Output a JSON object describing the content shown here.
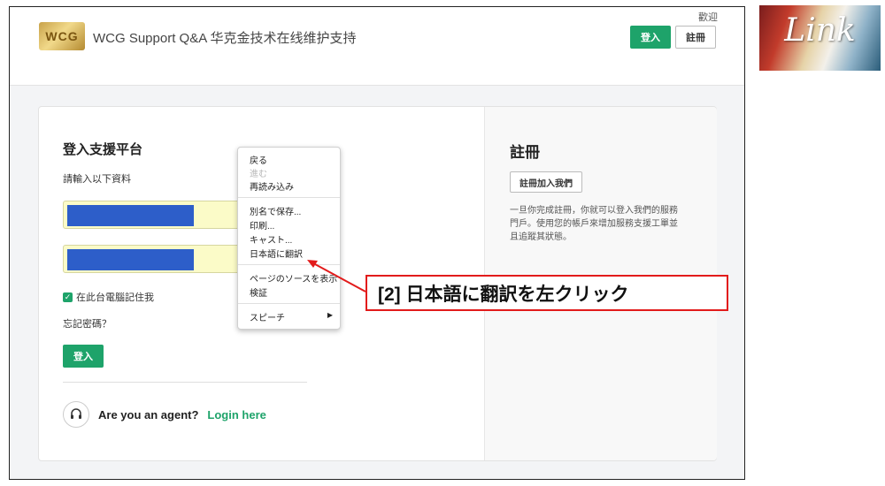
{
  "header": {
    "title": "WCG Support Q&A 华克金技术在线维护支持",
    "logo_text": "WCG",
    "welcome": "歡迎",
    "login_button": "登入",
    "register_button": "註冊"
  },
  "login_panel": {
    "title": "登入支援平台",
    "subtitle": "請輸入以下資料",
    "remember_label": "在此台電腦記住我",
    "forgot_link": "忘記密碼？",
    "login_button": "登入",
    "agent_question": "Are you an agent?",
    "agent_link": "Login here"
  },
  "register_panel": {
    "title": "註冊",
    "button": "註冊加入我們",
    "description": "一旦你完成註冊，你就可以登入我們的服務門戶。使用您的帳戶來增加服務支援工單並且追蹤其狀態。"
  },
  "context_menu": {
    "items": [
      {
        "label": "戻る",
        "disabled": false
      },
      {
        "label": "進む",
        "disabled": true
      },
      {
        "label": "再読み込み",
        "disabled": false
      },
      {
        "label": "別名で保存...",
        "disabled": false
      },
      {
        "label": "印刷...",
        "disabled": false
      },
      {
        "label": "キャスト...",
        "disabled": false
      },
      {
        "label": "日本語に翻訳",
        "disabled": false
      },
      {
        "label": "ページのソースを表示",
        "disabled": false
      },
      {
        "label": "検証",
        "disabled": false
      },
      {
        "label": "スピーチ",
        "disabled": false,
        "submenu": true
      }
    ]
  },
  "annotation": {
    "text": "[2] 日本語に翻訳を左クリック",
    "color": "#e21b1b"
  },
  "brand_logo": {
    "text": "Link"
  },
  "colors": {
    "accent": "#1ea36a",
    "autofill": "#fbfbc8",
    "redacted": "#2d5ec9"
  }
}
